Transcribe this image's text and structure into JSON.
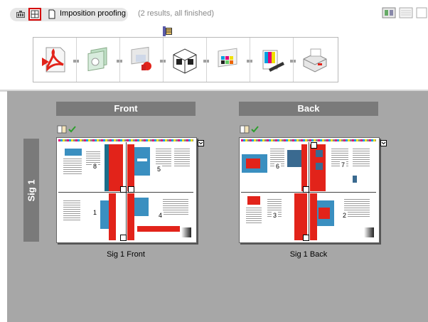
{
  "topbar": {
    "title": "Imposition proofing",
    "results_text": "(2 results, all finished)",
    "icons": [
      "job-icon",
      "imposition-view-icon",
      "document-icon"
    ]
  },
  "workflow": {
    "steps": [
      "pdf-icon",
      "preflight-icon",
      "normalize-icon",
      "imposition-icon",
      "color-icon",
      "proof-icon",
      "output-icon"
    ],
    "current_step_marker": "stack-icon"
  },
  "view_buttons": [
    "thumbnail-view-icon",
    "list-view-icon",
    "split-view-icon"
  ],
  "columns": {
    "front": "Front",
    "back": "Back"
  },
  "signatures": [
    {
      "label": "Sig 1",
      "front": {
        "caption": "Sig 1 Front",
        "pages": [
          "8",
          "5",
          "1",
          "4"
        ],
        "status": "finished"
      },
      "back": {
        "caption": "Sig 1 Back",
        "pages": [
          "6",
          "7",
          "3",
          "2"
        ],
        "status": "finished"
      }
    }
  ],
  "colors": {
    "accent_red": "#e2231a",
    "selected_border": "#d40000",
    "panel_bg": "#a7a7a7",
    "header_bg": "#7a7a7a",
    "check_green": "#2e9e2e"
  }
}
